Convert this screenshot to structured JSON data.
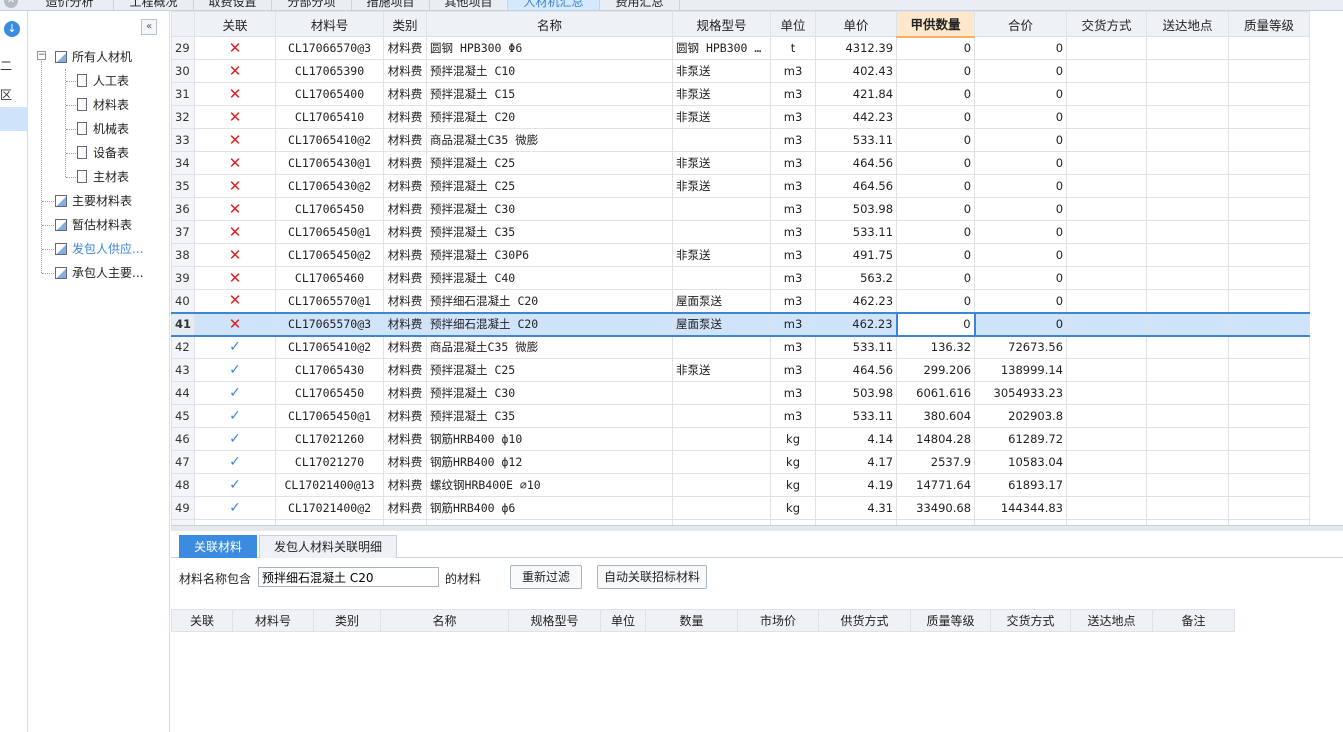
{
  "top_tabs": [
    "造价分析",
    "工程概况",
    "取费设置",
    "分部分项",
    "措施项目",
    "其他项目",
    "人材机汇总",
    "费用汇总"
  ],
  "left_strip": {
    "item1": "二",
    "item2": "区"
  },
  "tree": {
    "collapse_label": "«",
    "root": "所有人材机",
    "children": [
      "人工表",
      "材料表",
      "机械表",
      "设备表",
      "主材表"
    ],
    "others": [
      "主要材料表",
      "暂估材料表",
      "发包人供应...",
      "承包人主要..."
    ],
    "selected_index": 2
  },
  "grid": {
    "headers": [
      "关联",
      "材料号",
      "类别",
      "名称",
      "规格型号",
      "单位",
      "单价",
      "甲供数量",
      "合价",
      "交货方式",
      "送达地点",
      "质量等级"
    ],
    "highlight_header": "甲供数量",
    "selected_row": "41",
    "rows": [
      {
        "no": "29",
        "link": "x",
        "code": "CL17066570@3",
        "cat": "材料费",
        "name": "圆钢 HPB300 Φ6",
        "spec": "圆钢 HPB300 …",
        "unit": "t",
        "price": "4312.39",
        "qty": "0",
        "total": "0"
      },
      {
        "no": "30",
        "link": "x",
        "code": "CL17065390",
        "cat": "材料费",
        "name": "预拌混凝土 C10",
        "spec": "非泵送",
        "unit": "m3",
        "price": "402.43",
        "qty": "0",
        "total": "0"
      },
      {
        "no": "31",
        "link": "x",
        "code": "CL17065400",
        "cat": "材料费",
        "name": "预拌混凝土 C15",
        "spec": "非泵送",
        "unit": "m3",
        "price": "421.84",
        "qty": "0",
        "total": "0"
      },
      {
        "no": "32",
        "link": "x",
        "code": "CL17065410",
        "cat": "材料费",
        "name": "预拌混凝土 C20",
        "spec": "非泵送",
        "unit": "m3",
        "price": "442.23",
        "qty": "0",
        "total": "0"
      },
      {
        "no": "33",
        "link": "x",
        "code": "CL17065410@2",
        "cat": "材料费",
        "name": "商品混凝土C35 微膨",
        "spec": "",
        "unit": "m3",
        "price": "533.11",
        "qty": "0",
        "total": "0"
      },
      {
        "no": "34",
        "link": "x",
        "code": "CL17065430@1",
        "cat": "材料费",
        "name": "预拌混凝土 C25",
        "spec": "非泵送",
        "unit": "m3",
        "price": "464.56",
        "qty": "0",
        "total": "0"
      },
      {
        "no": "35",
        "link": "x",
        "code": "CL17065430@2",
        "cat": "材料费",
        "name": "预拌混凝土 C25",
        "spec": "非泵送",
        "unit": "m3",
        "price": "464.56",
        "qty": "0",
        "total": "0"
      },
      {
        "no": "36",
        "link": "x",
        "code": "CL17065450",
        "cat": "材料费",
        "name": "预拌混凝土 C30",
        "spec": "",
        "unit": "m3",
        "price": "503.98",
        "qty": "0",
        "total": "0"
      },
      {
        "no": "37",
        "link": "x",
        "code": "CL17065450@1",
        "cat": "材料费",
        "name": "预拌混凝土 C35",
        "spec": "",
        "unit": "m3",
        "price": "533.11",
        "qty": "0",
        "total": "0"
      },
      {
        "no": "38",
        "link": "x",
        "code": "CL17065450@2",
        "cat": "材料费",
        "name": "预拌混凝土 C30P6",
        "spec": "非泵送",
        "unit": "m3",
        "price": "491.75",
        "qty": "0",
        "total": "0"
      },
      {
        "no": "39",
        "link": "x",
        "code": "CL17065460",
        "cat": "材料费",
        "name": "预拌混凝土 C40",
        "spec": "",
        "unit": "m3",
        "price": "563.2",
        "qty": "0",
        "total": "0"
      },
      {
        "no": "40",
        "link": "x",
        "code": "CL17065570@1",
        "cat": "材料费",
        "name": "预拌细石混凝土 C20",
        "spec": "屋面泵送",
        "unit": "m3",
        "price": "462.23",
        "qty": "0",
        "total": "0"
      },
      {
        "no": "41",
        "link": "x",
        "code": "CL17065570@3",
        "cat": "材料费",
        "name": "预拌细石混凝土 C20",
        "spec": "屋面泵送",
        "unit": "m3",
        "price": "462.23",
        "qty": "0",
        "total": "0"
      },
      {
        "no": "42",
        "link": "v",
        "code": "CL17065410@2",
        "cat": "材料费",
        "name": "商品混凝土C35 微膨",
        "spec": "",
        "unit": "m3",
        "price": "533.11",
        "qty": "136.32",
        "total": "72673.56"
      },
      {
        "no": "43",
        "link": "v",
        "code": "CL17065430",
        "cat": "材料费",
        "name": "预拌混凝土 C25",
        "spec": "非泵送",
        "unit": "m3",
        "price": "464.56",
        "qty": "299.206",
        "total": "138999.14"
      },
      {
        "no": "44",
        "link": "v",
        "code": "CL17065450",
        "cat": "材料费",
        "name": "预拌混凝土 C30",
        "spec": "",
        "unit": "m3",
        "price": "503.98",
        "qty": "6061.616",
        "total": "3054933.23"
      },
      {
        "no": "45",
        "link": "v",
        "code": "CL17065450@1",
        "cat": "材料费",
        "name": "预拌混凝土 C35",
        "spec": "",
        "unit": "m3",
        "price": "533.11",
        "qty": "380.604",
        "total": "202903.8"
      },
      {
        "no": "46",
        "link": "v",
        "code": "CL17021260",
        "cat": "材料费",
        "name": "钢筋HRB400 ф10",
        "spec": "",
        "unit": "kg",
        "price": "4.14",
        "qty": "14804.28",
        "total": "61289.72"
      },
      {
        "no": "47",
        "link": "v",
        "code": "CL17021270",
        "cat": "材料费",
        "name": "钢筋HRB400 ф12",
        "spec": "",
        "unit": "kg",
        "price": "4.17",
        "qty": "2537.9",
        "total": "10583.04"
      },
      {
        "no": "48",
        "link": "v",
        "code": "CL17021400@13",
        "cat": "材料费",
        "name": "螺纹钢HRB400E ⌀10",
        "spec": "",
        "unit": "kg",
        "price": "4.19",
        "qty": "14771.64",
        "total": "61893.17"
      },
      {
        "no": "49",
        "link": "v",
        "code": "CL17021400@2",
        "cat": "材料费",
        "name": "钢筋HRB400 ф6",
        "spec": "",
        "unit": "kg",
        "price": "4.31",
        "qty": "33490.68",
        "total": "144344.83"
      },
      {
        "no": "",
        "link": "",
        "code": "",
        "cat": "材料费",
        "name": "",
        "spec": "",
        "unit": "",
        "price": "",
        "qty": "",
        "total": ""
      }
    ]
  },
  "bottom_tabs": [
    "关联材料",
    "发包人材料关联明细"
  ],
  "filter": {
    "prefix": "材料名称包含",
    "value": "预拌细石混凝土 C20",
    "suffix": "的材料",
    "refilter_button": "重新过滤",
    "auto_button": "自动关联招标材料"
  },
  "lower_grid": {
    "headers": [
      "关联",
      "材料号",
      "类别",
      "名称",
      "规格型号",
      "单位",
      "数量",
      "市场价",
      "供货方式",
      "质量等级",
      "交货方式",
      "送达地点",
      "备注"
    ]
  },
  "colors": {
    "accent": "#3b86d6",
    "x_mark": "#e02020",
    "highlight_header": "#fde8cc"
  }
}
